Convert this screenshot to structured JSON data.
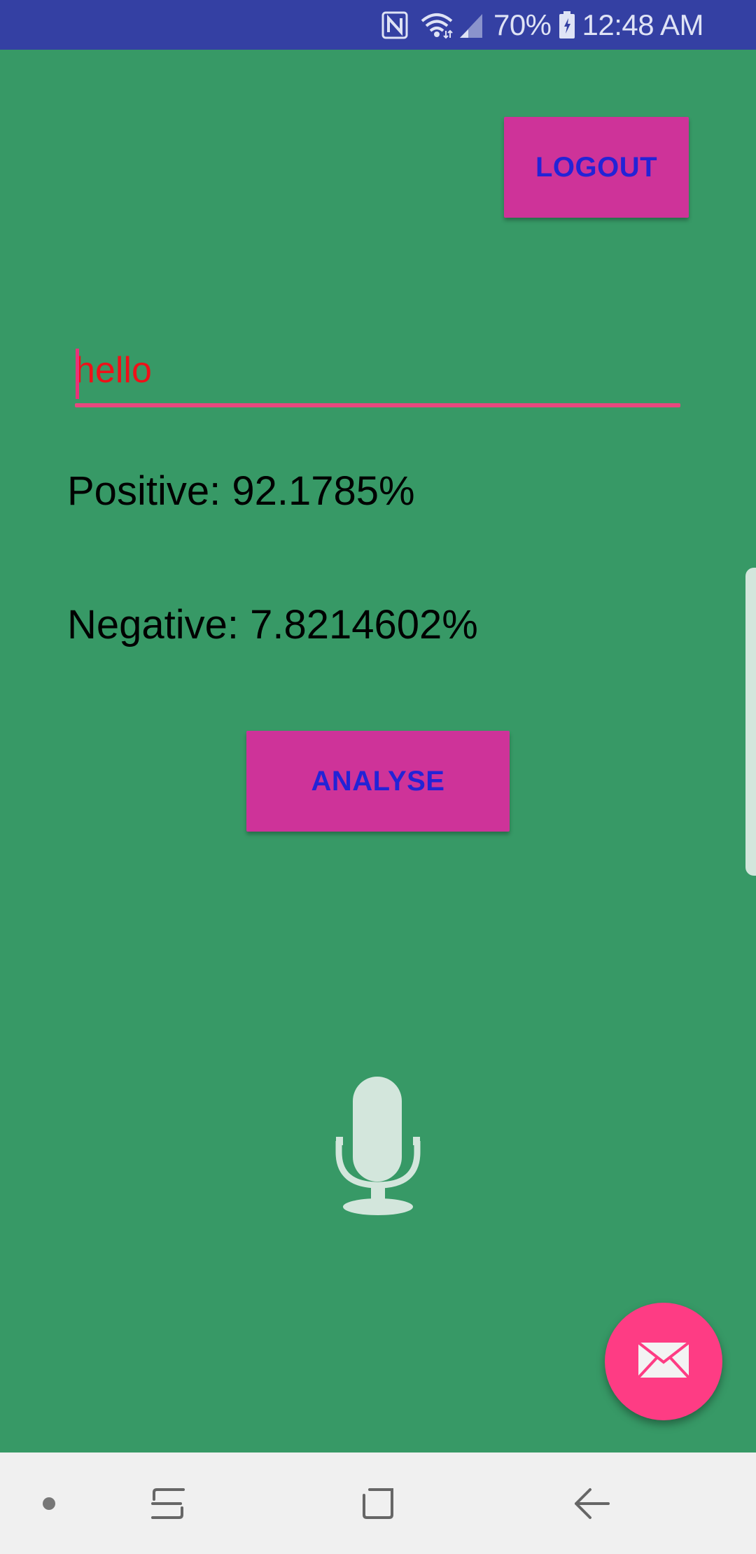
{
  "status_bar": {
    "battery": "70%",
    "time": "12:48 AM",
    "icons": [
      "nfc-icon",
      "wifi-icon",
      "signal-icon",
      "battery-icon"
    ]
  },
  "header": {
    "logout_label": "LOGOUT"
  },
  "input": {
    "value": "hello"
  },
  "results": {
    "positive": "Positive: 92.1785%",
    "negative": "Negative: 7.8214602%"
  },
  "actions": {
    "analyse_label": "ANALYSE"
  },
  "icons": {
    "mic": "microphone-icon",
    "fab": "mail-icon"
  },
  "nav_bar": {
    "items": [
      "dot-icon",
      "recent-apps-icon",
      "home-icon",
      "back-icon"
    ]
  },
  "colors": {
    "background": "#379966",
    "status_bar": "#3440a3",
    "button": "#ce3399",
    "button_text": "#2323d6",
    "fab": "#fe3c84",
    "input_text": "#f01018",
    "underline": "#e8487e"
  }
}
